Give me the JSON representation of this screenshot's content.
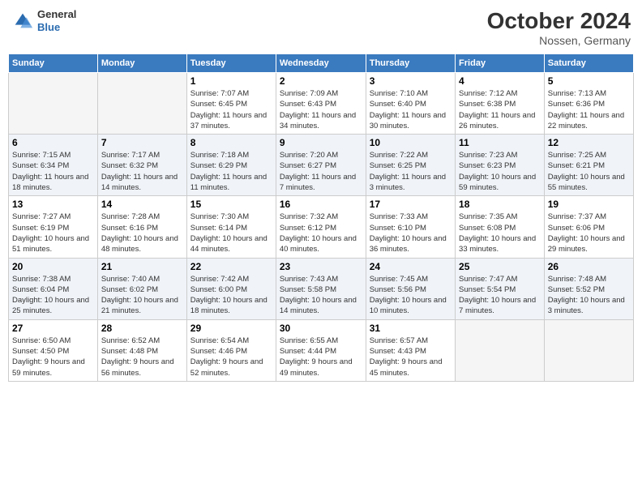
{
  "header": {
    "logo_general": "General",
    "logo_blue": "Blue",
    "month": "October 2024",
    "location": "Nossen, Germany"
  },
  "weekdays": [
    "Sunday",
    "Monday",
    "Tuesday",
    "Wednesday",
    "Thursday",
    "Friday",
    "Saturday"
  ],
  "weeks": [
    [
      {
        "day": "",
        "info": ""
      },
      {
        "day": "",
        "info": ""
      },
      {
        "day": "1",
        "info": "Sunrise: 7:07 AM\nSunset: 6:45 PM\nDaylight: 11 hours and 37 minutes."
      },
      {
        "day": "2",
        "info": "Sunrise: 7:09 AM\nSunset: 6:43 PM\nDaylight: 11 hours and 34 minutes."
      },
      {
        "day": "3",
        "info": "Sunrise: 7:10 AM\nSunset: 6:40 PM\nDaylight: 11 hours and 30 minutes."
      },
      {
        "day": "4",
        "info": "Sunrise: 7:12 AM\nSunset: 6:38 PM\nDaylight: 11 hours and 26 minutes."
      },
      {
        "day": "5",
        "info": "Sunrise: 7:13 AM\nSunset: 6:36 PM\nDaylight: 11 hours and 22 minutes."
      }
    ],
    [
      {
        "day": "6",
        "info": "Sunrise: 7:15 AM\nSunset: 6:34 PM\nDaylight: 11 hours and 18 minutes."
      },
      {
        "day": "7",
        "info": "Sunrise: 7:17 AM\nSunset: 6:32 PM\nDaylight: 11 hours and 14 minutes."
      },
      {
        "day": "8",
        "info": "Sunrise: 7:18 AM\nSunset: 6:29 PM\nDaylight: 11 hours and 11 minutes."
      },
      {
        "day": "9",
        "info": "Sunrise: 7:20 AM\nSunset: 6:27 PM\nDaylight: 11 hours and 7 minutes."
      },
      {
        "day": "10",
        "info": "Sunrise: 7:22 AM\nSunset: 6:25 PM\nDaylight: 11 hours and 3 minutes."
      },
      {
        "day": "11",
        "info": "Sunrise: 7:23 AM\nSunset: 6:23 PM\nDaylight: 10 hours and 59 minutes."
      },
      {
        "day": "12",
        "info": "Sunrise: 7:25 AM\nSunset: 6:21 PM\nDaylight: 10 hours and 55 minutes."
      }
    ],
    [
      {
        "day": "13",
        "info": "Sunrise: 7:27 AM\nSunset: 6:19 PM\nDaylight: 10 hours and 51 minutes."
      },
      {
        "day": "14",
        "info": "Sunrise: 7:28 AM\nSunset: 6:16 PM\nDaylight: 10 hours and 48 minutes."
      },
      {
        "day": "15",
        "info": "Sunrise: 7:30 AM\nSunset: 6:14 PM\nDaylight: 10 hours and 44 minutes."
      },
      {
        "day": "16",
        "info": "Sunrise: 7:32 AM\nSunset: 6:12 PM\nDaylight: 10 hours and 40 minutes."
      },
      {
        "day": "17",
        "info": "Sunrise: 7:33 AM\nSunset: 6:10 PM\nDaylight: 10 hours and 36 minutes."
      },
      {
        "day": "18",
        "info": "Sunrise: 7:35 AM\nSunset: 6:08 PM\nDaylight: 10 hours and 33 minutes."
      },
      {
        "day": "19",
        "info": "Sunrise: 7:37 AM\nSunset: 6:06 PM\nDaylight: 10 hours and 29 minutes."
      }
    ],
    [
      {
        "day": "20",
        "info": "Sunrise: 7:38 AM\nSunset: 6:04 PM\nDaylight: 10 hours and 25 minutes."
      },
      {
        "day": "21",
        "info": "Sunrise: 7:40 AM\nSunset: 6:02 PM\nDaylight: 10 hours and 21 minutes."
      },
      {
        "day": "22",
        "info": "Sunrise: 7:42 AM\nSunset: 6:00 PM\nDaylight: 10 hours and 18 minutes."
      },
      {
        "day": "23",
        "info": "Sunrise: 7:43 AM\nSunset: 5:58 PM\nDaylight: 10 hours and 14 minutes."
      },
      {
        "day": "24",
        "info": "Sunrise: 7:45 AM\nSunset: 5:56 PM\nDaylight: 10 hours and 10 minutes."
      },
      {
        "day": "25",
        "info": "Sunrise: 7:47 AM\nSunset: 5:54 PM\nDaylight: 10 hours and 7 minutes."
      },
      {
        "day": "26",
        "info": "Sunrise: 7:48 AM\nSunset: 5:52 PM\nDaylight: 10 hours and 3 minutes."
      }
    ],
    [
      {
        "day": "27",
        "info": "Sunrise: 6:50 AM\nSunset: 4:50 PM\nDaylight: 9 hours and 59 minutes."
      },
      {
        "day": "28",
        "info": "Sunrise: 6:52 AM\nSunset: 4:48 PM\nDaylight: 9 hours and 56 minutes."
      },
      {
        "day": "29",
        "info": "Sunrise: 6:54 AM\nSunset: 4:46 PM\nDaylight: 9 hours and 52 minutes."
      },
      {
        "day": "30",
        "info": "Sunrise: 6:55 AM\nSunset: 4:44 PM\nDaylight: 9 hours and 49 minutes."
      },
      {
        "day": "31",
        "info": "Sunrise: 6:57 AM\nSunset: 4:43 PM\nDaylight: 9 hours and 45 minutes."
      },
      {
        "day": "",
        "info": ""
      },
      {
        "day": "",
        "info": ""
      }
    ]
  ]
}
